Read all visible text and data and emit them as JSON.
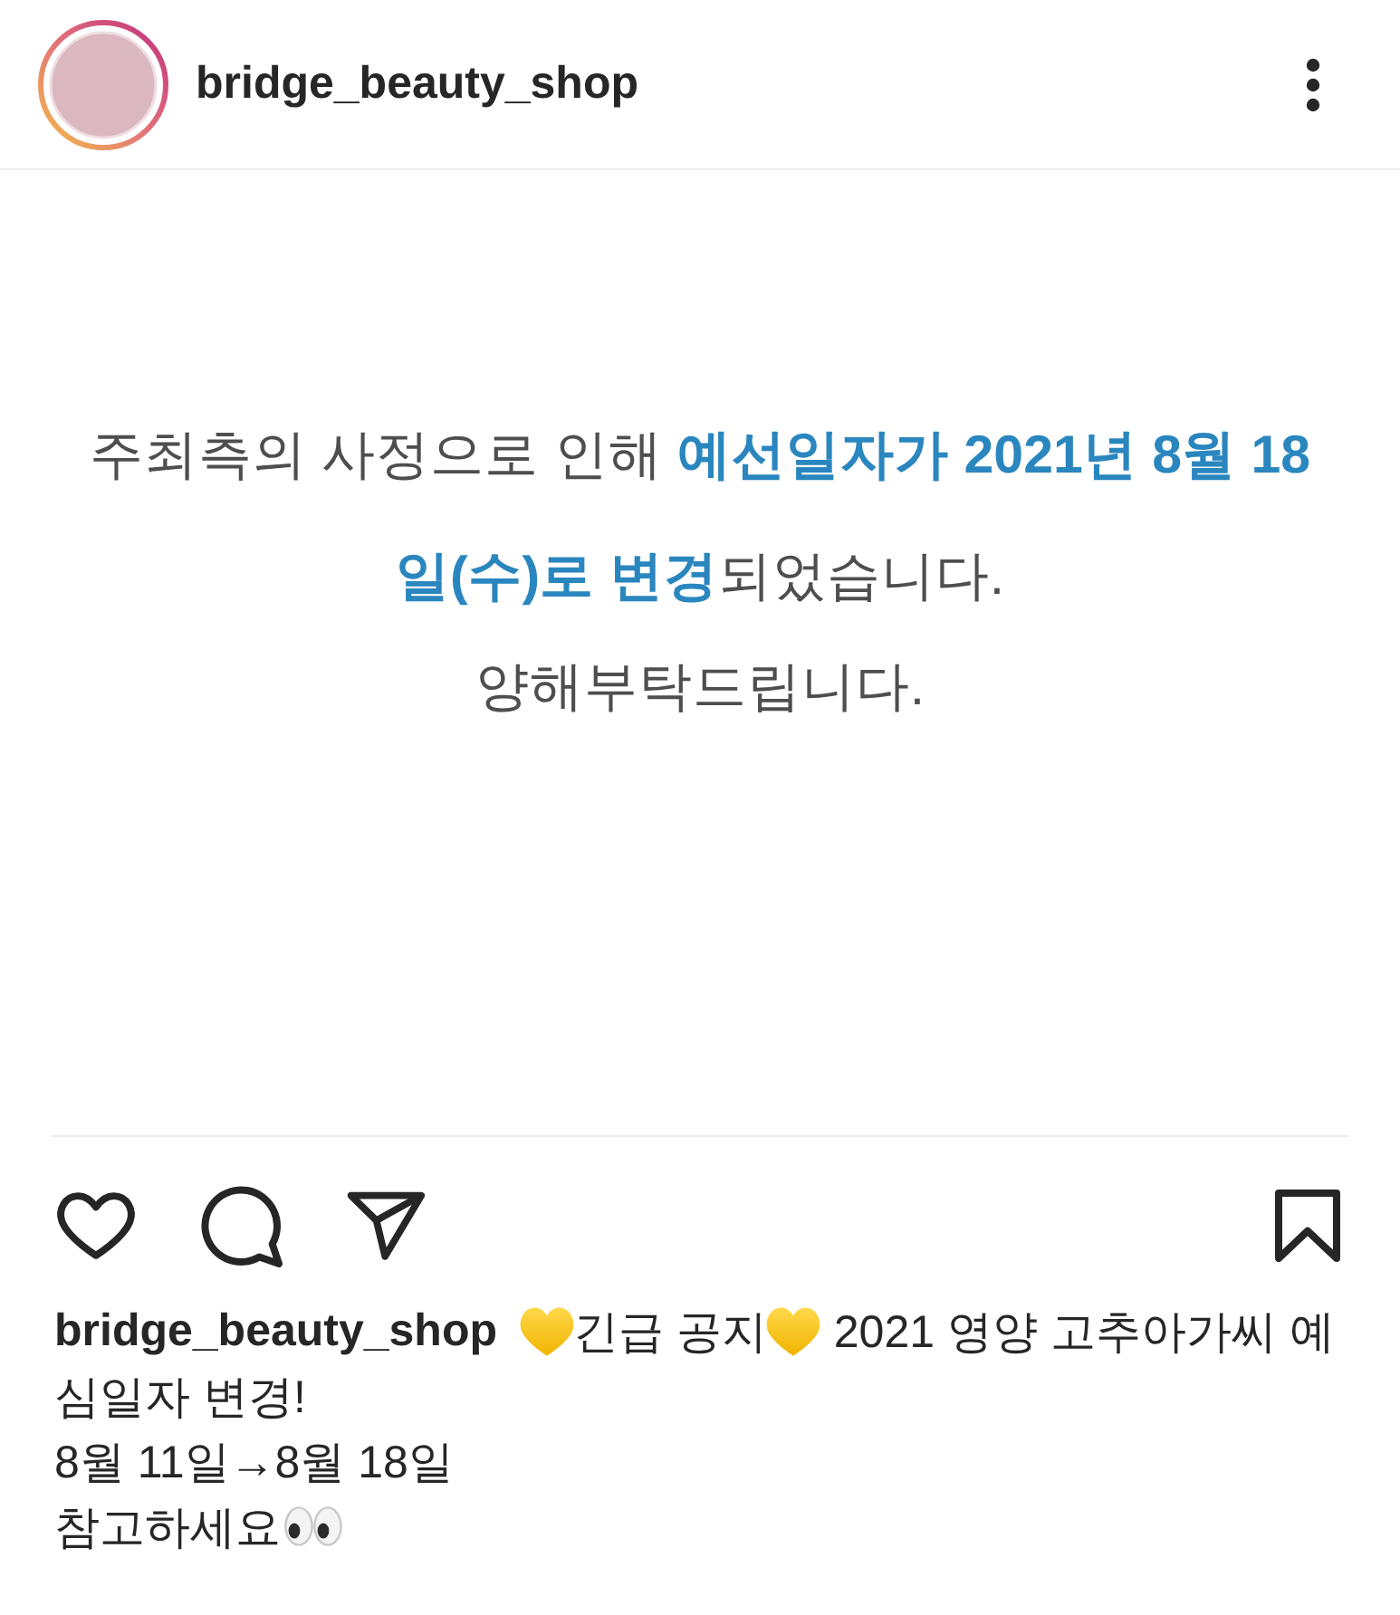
{
  "header": {
    "username": "bridge_beauty_shop"
  },
  "post_image": {
    "notice": "주최측의 사정으로 인해 **예선일자가 2021년 8월 18일(수)로 변경**되었습니다.",
    "closing": "양해부탁드립니다."
  },
  "actions": {
    "liked": false,
    "saved": false
  },
  "caption": {
    "lines": [
      [
        {
          "kind": "username",
          "text": "bridge_beauty_shop"
        },
        {
          "kind": "heart"
        },
        {
          "kind": "text",
          "text": "긴급 공지"
        },
        {
          "kind": "heart"
        },
        {
          "kind": "text",
          "text": " 2021 영양 고추아가씨 예"
        }
      ],
      [
        {
          "kind": "text",
          "text": "심일자 변경!"
        }
      ],
      [
        {
          "kind": "text",
          "text": "8월 11일→8월 18일"
        }
      ],
      [
        {
          "kind": "text",
          "text": "참고하세요"
        },
        {
          "kind": "eyes"
        }
      ]
    ]
  }
}
